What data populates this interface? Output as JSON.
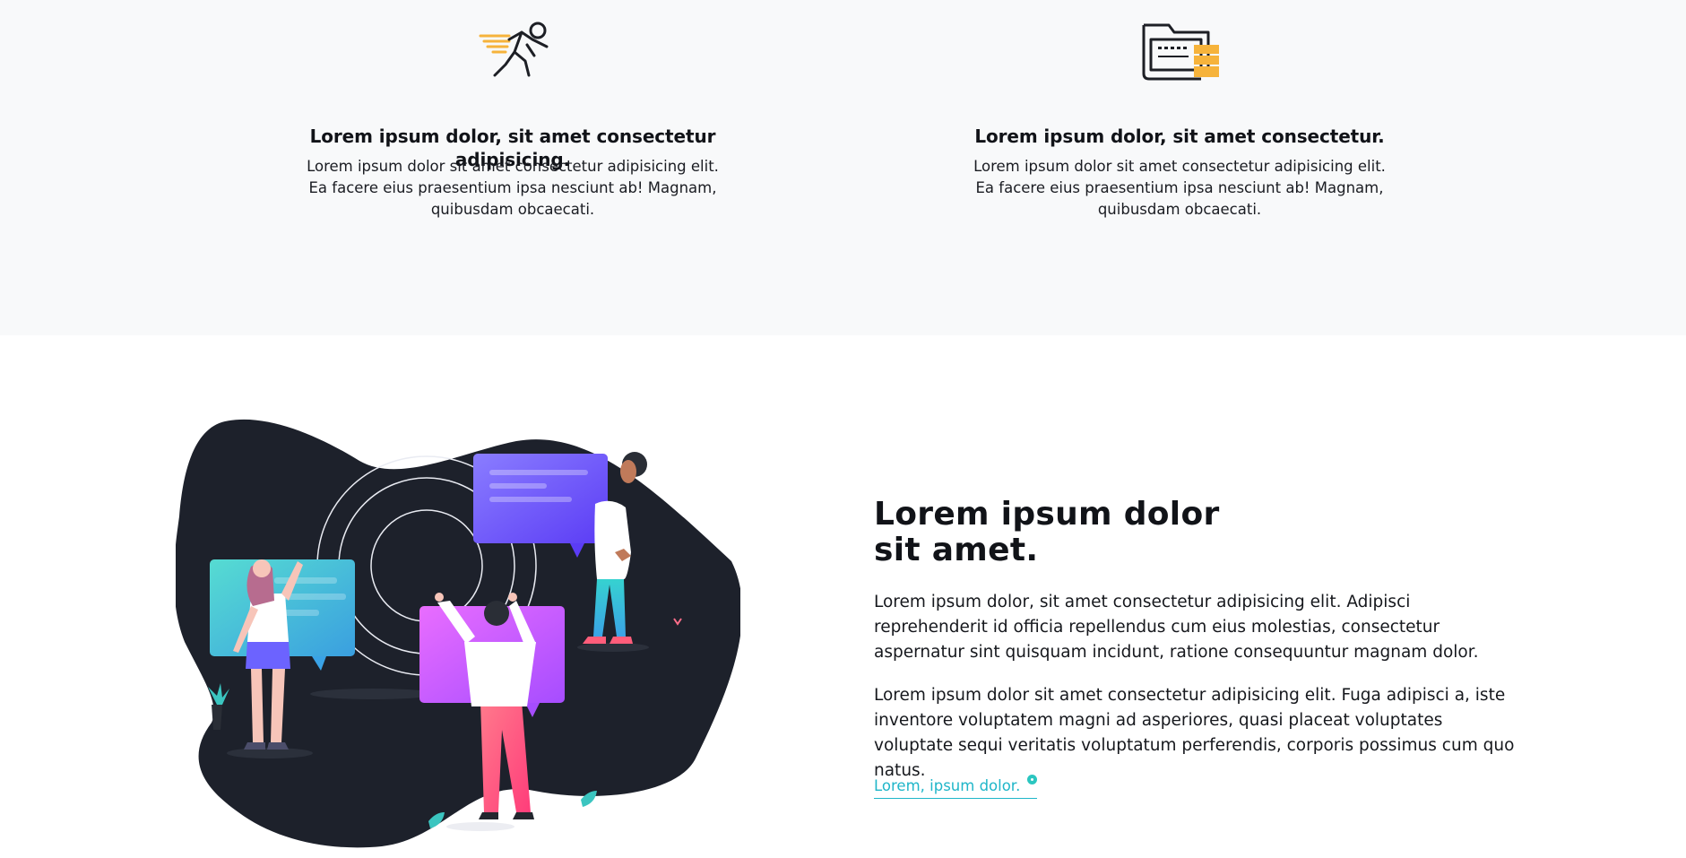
{
  "features": [
    {
      "icon": "runner-icon",
      "title": "Lorem ipsum dolor, sit amet consectetur adipisicing.",
      "description": "Lorem ipsum dolor sit amet consectetur adipisicing elit. Ea facere eius praesentium ipsa nesciunt ab! Magnam, quibusdam obcaecati."
    },
    {
      "icon": "folder-database-icon",
      "title": "Lorem ipsum dolor, sit amet consectetur.",
      "description": "Lorem ipsum dolor sit amet consectetur adipisicing elit. Ea facere eius praesentium ipsa nesciunt ab! Magnam, quibusdam obcaecati."
    }
  ],
  "about": {
    "title": "Lorem ipsum dolor sit amet.",
    "paragraphs": [
      "Lorem ipsum dolor, sit amet consectetur adipisicing elit. Adipisci reprehenderit id officia repellendus cum eius molestias, consectetur aspernatur sint quisquam incidunt, ratione consequuntur magnam dolor.",
      "Lorem ipsum dolor sit amet consectetur adipisicing elit. Fuga adipisci a, iste inventore voluptatem magni ad asperiores, quasi placeat voluptates voluptate sequi veritatis voluptatum perferendis, corporis possimus cum quo natus."
    ],
    "link_label": "Lorem, ipsum dolor.",
    "illustration": "people-chat-bubbles-illustration"
  },
  "colors": {
    "accent": "#1fb6c9",
    "icon_yellow": "#f6b33b",
    "blob": "#1d212b",
    "features_bg": "#f8f9fa"
  }
}
